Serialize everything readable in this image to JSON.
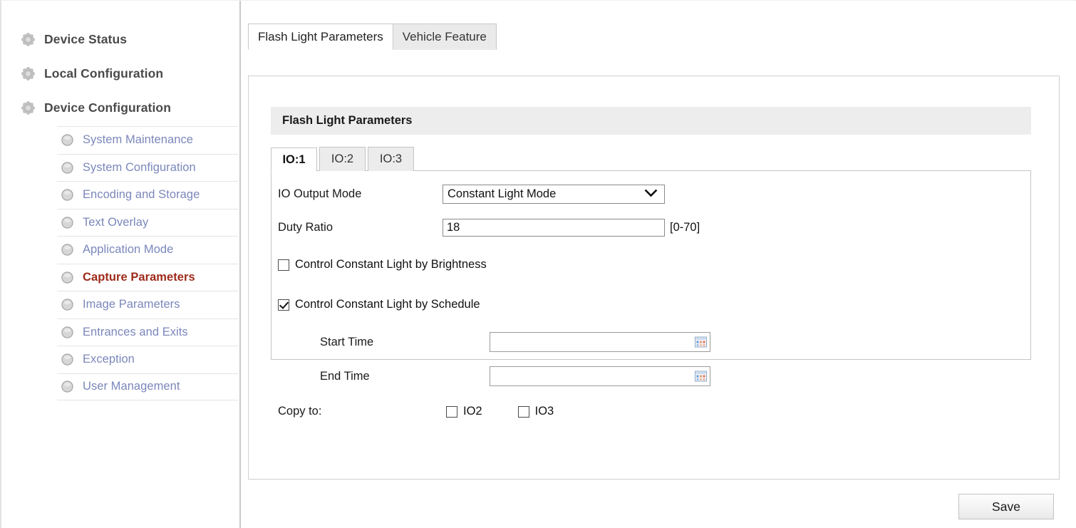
{
  "sidebar": {
    "top_items": [
      {
        "label": "Device Status",
        "icon": "gear-icon"
      },
      {
        "label": "Local Configuration",
        "icon": "gear-icon"
      },
      {
        "label": "Device Configuration",
        "icon": "gear-icon"
      }
    ],
    "sub_items": [
      {
        "label": "System Maintenance",
        "active": false
      },
      {
        "label": "System Configuration",
        "active": false
      },
      {
        "label": "Encoding and Storage",
        "active": false
      },
      {
        "label": "Text Overlay",
        "active": false
      },
      {
        "label": "Application Mode",
        "active": false
      },
      {
        "label": "Capture Parameters",
        "active": true
      },
      {
        "label": "Image Parameters",
        "active": false
      },
      {
        "label": "Entrances and Exits",
        "active": false
      },
      {
        "label": "Exception",
        "active": false
      },
      {
        "label": "User Management",
        "active": false
      }
    ],
    "active_color": "#9e2a19",
    "link_color": "#7b87bb"
  },
  "top_tabs": [
    {
      "label": "Flash Light Parameters",
      "active": true
    },
    {
      "label": "Vehicle Feature",
      "active": false
    }
  ],
  "section": {
    "title": "Flash Light Parameters"
  },
  "io_tabs": [
    {
      "label": "IO:1",
      "active": true
    },
    {
      "label": "IO:2",
      "active": false
    },
    {
      "label": "IO:3",
      "active": false
    }
  ],
  "form": {
    "io_output_mode": {
      "label": "IO Output Mode",
      "value": "Constant Light Mode",
      "options": [
        "Constant Light Mode"
      ],
      "icon": "chevron-down-icon"
    },
    "duty_ratio": {
      "label": "Duty Ratio",
      "value": "18",
      "placeholder": "",
      "hint": "[0-70]"
    },
    "control_by_brightness": {
      "label": "Control Constant Light by Brightness",
      "checked": false
    },
    "control_by_schedule": {
      "label": "Control Constant Light by Schedule",
      "checked": true
    },
    "start_time": {
      "label": "Start Time",
      "value": "",
      "placeholder": "",
      "icon": "calendar-icon"
    },
    "end_time": {
      "label": "End Time",
      "value": "",
      "placeholder": "",
      "icon": "calendar-icon"
    },
    "copy_to": {
      "label": "Copy to:",
      "targets": [
        {
          "label": "IO2",
          "checked": false
        },
        {
          "label": "IO3",
          "checked": false
        }
      ]
    }
  },
  "footer": {
    "save_label": "Save"
  }
}
